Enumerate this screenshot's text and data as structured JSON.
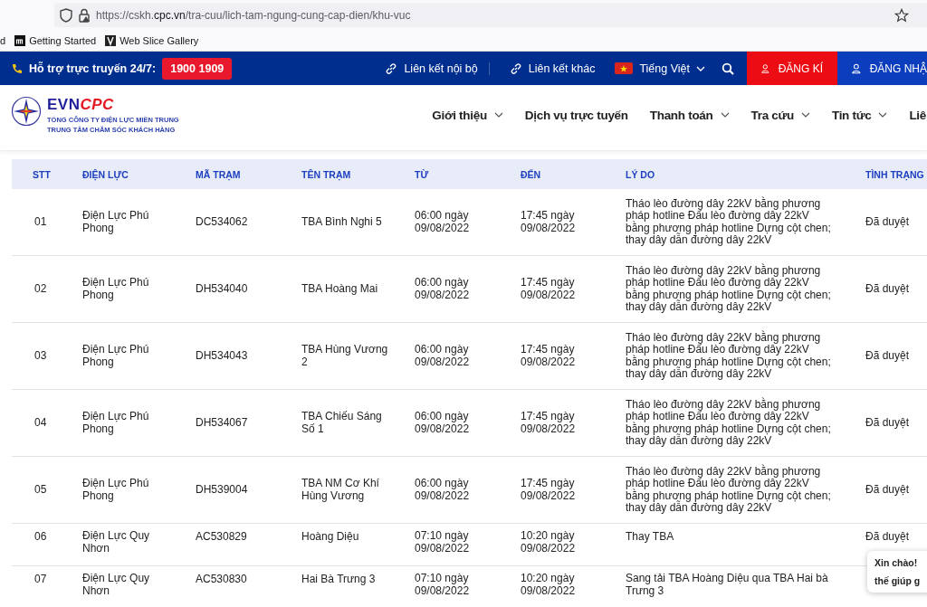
{
  "browser": {
    "url": "https://cskh.**cpc.vn**/tra-cuu/lich-tam-ngung-cung-cap-dien/khu-vuc",
    "bookmarks": [
      {
        "label": "d",
        "kind": "cut"
      },
      {
        "label": "Getting Started",
        "kind": "m"
      },
      {
        "label": "Web Slice Gallery",
        "kind": "slice"
      }
    ]
  },
  "topbar": {
    "support_label": "Hỗ trợ trực truyến 24/7:",
    "hotline": "1900 1909",
    "links": [
      "Liên kết nội bộ",
      "Liên kết khác"
    ],
    "language": "Tiếng Việt",
    "buttons": [
      {
        "label": "ĐĂNG KÍ",
        "kind": "register"
      },
      {
        "label": "ĐĂNG NHẬ",
        "kind": "login"
      }
    ]
  },
  "header": {
    "logo": {
      "evn": "EVN",
      "cpc": "CPC",
      "line_1": "TỔNG CÔNG TY ĐIỆN LỰC MIỀN TRUNG",
      "line_2": "TRUNG TÂM CHĂM SÓC KHÁCH HÀNG"
    },
    "nav": [
      {
        "label": "Giới thiệu",
        "dropdown": true
      },
      {
        "label": "Dịch vụ trực tuyến",
        "dropdown": false
      },
      {
        "label": "Thanh toán",
        "dropdown": true
      },
      {
        "label": "Tra cứu",
        "dropdown": true
      },
      {
        "label": "Tin tức",
        "dropdown": true
      },
      {
        "label": "Liê",
        "dropdown": false
      }
    ]
  },
  "table": {
    "columns": [
      "STT",
      "ĐIỆN LỰC",
      "MÃ TRẠM",
      "TÊN TRẠM",
      "TỪ",
      "ĐẾN",
      "LÝ DO",
      "TÌNH TRẠNG"
    ],
    "rows": [
      {
        "stt": "01",
        "dien_luc": "Điện Lực Phú Phong",
        "ma_tram": "DC534062",
        "ten_tram": "TBA Bình Nghi 5",
        "tu": "06:00 ngày 09/08/2022",
        "den": "17:45 ngày 09/08/2022",
        "ly_do": "Tháo lèo đường dây 22kV bằng phương pháp hotline Đấu lèo đường dây 22kV bằng phương pháp hotline Dựng cột chen; thay dây dẫn đường dây 22kV",
        "tinh_trang": "Đã duyệt"
      },
      {
        "stt": "02",
        "dien_luc": "Điện Lực Phú Phong",
        "ma_tram": "DH534040",
        "ten_tram": "TBA Hoàng Mai",
        "tu": "06:00 ngày 09/08/2022",
        "den": "17:45 ngày 09/08/2022",
        "ly_do": "Tháo lèo đường dây 22kV bằng phương pháp hotline Đấu lèo đường dây 22kV bằng phương pháp hotline Dựng cột chen; thay dây dẫn đường dây 22kV",
        "tinh_trang": "Đã duyệt"
      },
      {
        "stt": "03",
        "dien_luc": "Điện Lực Phú Phong",
        "ma_tram": "DH534043",
        "ten_tram": "TBA Hùng Vương 2",
        "tu": "06:00 ngày 09/08/2022",
        "den": "17:45 ngày 09/08/2022",
        "ly_do": "Tháo lèo đường dây 22kV bằng phương pháp hotline Đấu lèo đường dây 22kV bằng phương pháp hotline Dựng cột chen; thay dây dẫn đường dây 22kV",
        "tinh_trang": "Đã duyệt"
      },
      {
        "stt": "04",
        "dien_luc": "Điện Lực Phú Phong",
        "ma_tram": "DH534067",
        "ten_tram": "TBA Chiếu Sáng Số 1",
        "tu": "06:00 ngày 09/08/2022",
        "den": "17:45 ngày 09/08/2022",
        "ly_do": "Tháo lèo đường dây 22kV bằng phương pháp hotline Đấu lèo đường dây 22kV bằng phương pháp hotline Dựng cột chen; thay dây dẫn đường dây 22kV",
        "tinh_trang": "Đã duyệt"
      },
      {
        "stt": "05",
        "dien_luc": "Điện Lực Phú Phong",
        "ma_tram": "DH539004",
        "ten_tram": "TBA NM Cơ Khí Hùng Vương",
        "tu": "06:00 ngày 09/08/2022",
        "den": "17:45 ngày 09/08/2022",
        "ly_do": "Tháo lèo đường dây 22kV bằng phương pháp hotline Đấu lèo đường dây 22kV bằng phương pháp hotline Dựng cột chen; thay dây dẫn đường dây 22kV",
        "tinh_trang": "Đã duyệt"
      },
      {
        "stt": "06",
        "dien_luc": "Điện Lực Quy Nhơn",
        "ma_tram": "AC530829",
        "ten_tram": "Hoàng Diệu",
        "tu": "07:10 ngày 09/08/2022",
        "den": "10:20 ngày 09/08/2022",
        "ly_do": "Thay TBA",
        "tinh_trang": "Đã duyệt"
      },
      {
        "stt": "07",
        "dien_luc": "Điện Lực Quy Nhơn",
        "ma_tram": "AC530830",
        "ten_tram": "Hai Bà Trưng 3",
        "tu": "07:10 ngày 09/08/2022",
        "den": "10:20 ngày 09/08/2022",
        "ly_do": "Sang tải TBA Hoàng Diệu qua TBA Hai bà Trưng 3"
      }
    ]
  },
  "chat": {
    "lines": [
      "Xin chào!",
      "thế giúp g"
    ]
  }
}
